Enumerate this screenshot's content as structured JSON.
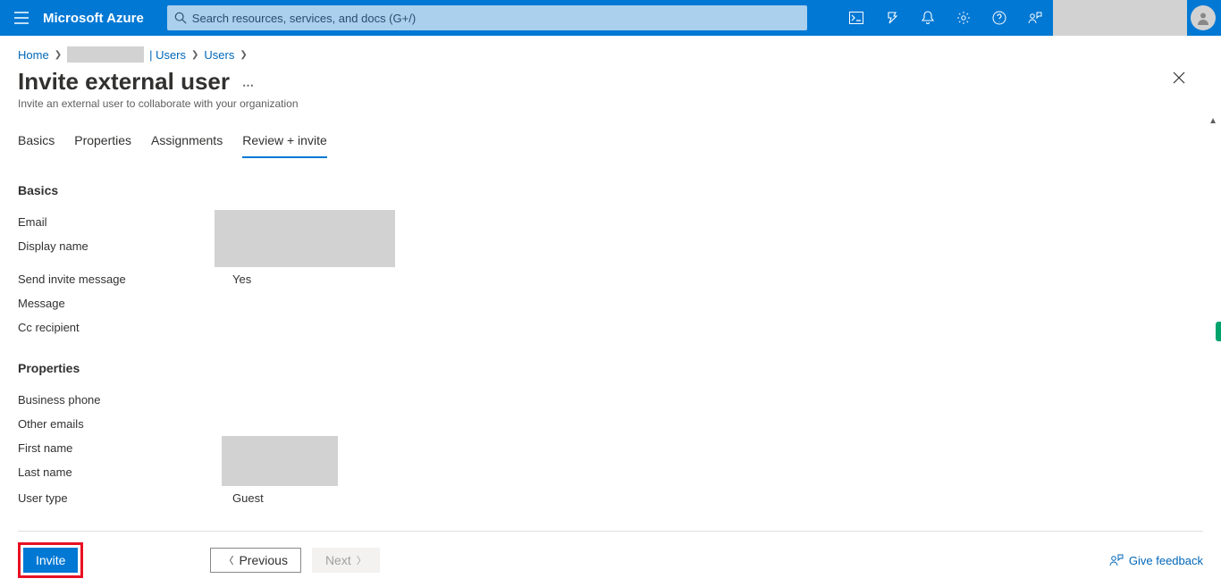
{
  "header": {
    "brand": "Microsoft Azure",
    "search_placeholder": "Search resources, services, and docs (G+/)"
  },
  "breadcrumb": {
    "home": "Home",
    "users_suffix": "| Users",
    "users2": "Users"
  },
  "page": {
    "title": "Invite external user",
    "subtitle": "Invite an external user to collaborate with your organization"
  },
  "tabs": {
    "basics": "Basics",
    "properties": "Properties",
    "assignments": "Assignments",
    "review": "Review + invite"
  },
  "sections": {
    "basics_h": "Basics",
    "properties_h": "Properties"
  },
  "basics": {
    "email_label": "Email",
    "display_name_label": "Display name",
    "send_invite_label": "Send invite message",
    "send_invite_value": "Yes",
    "message_label": "Message",
    "cc_label": "Cc recipient"
  },
  "properties": {
    "business_phone_label": "Business phone",
    "other_emails_label": "Other emails",
    "first_name_label": "First name",
    "last_name_label": "Last name",
    "user_type_label": "User type",
    "user_type_value": "Guest"
  },
  "footer": {
    "invite": "Invite",
    "previous": "Previous",
    "next": "Next",
    "feedback": "Give feedback"
  }
}
